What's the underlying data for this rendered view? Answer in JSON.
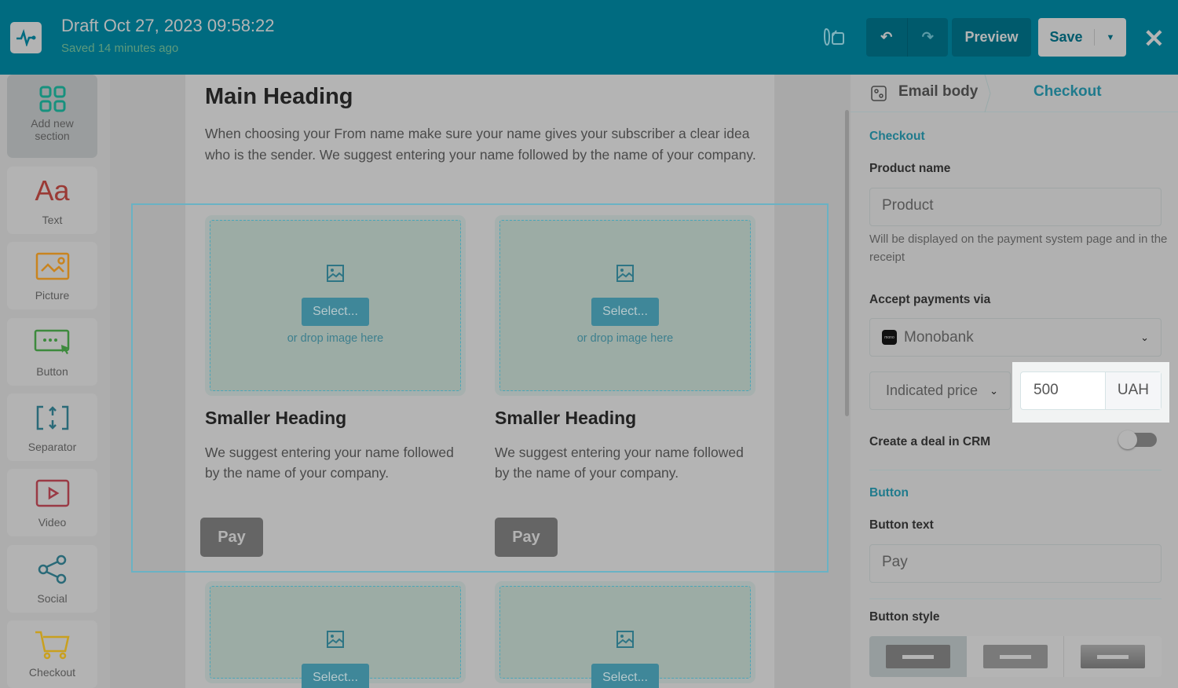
{
  "header": {
    "title": "Draft Oct 27, 2023 09:58:22",
    "subtitle": "Saved 14 minutes ago",
    "preview": "Preview",
    "save": "Save"
  },
  "sidebar": {
    "items": [
      {
        "label": "Add new section"
      },
      {
        "label": "Text",
        "glyph": "Aa"
      },
      {
        "label": "Picture"
      },
      {
        "label": "Button"
      },
      {
        "label": "Separator"
      },
      {
        "label": "Video"
      },
      {
        "label": "Social"
      },
      {
        "label": "Checkout"
      }
    ]
  },
  "email": {
    "heading": "Main Heading",
    "paragraph": "When choosing your From name make sure your name gives your subscriber a clear idea who is the sender. We suggest entering your name followed by the name of your company.",
    "columns": [
      {
        "select": "Select...",
        "drop": "or drop image here",
        "heading": "Smaller Heading",
        "text": "We suggest entering your name followed by the name of your company.",
        "button": "Pay"
      },
      {
        "select": "Select...",
        "drop": "or drop image here",
        "heading": "Smaller Heading",
        "text": "We suggest entering your name followed by the name of your company.",
        "button": "Pay"
      }
    ],
    "next_row": [
      {
        "select": "Select..."
      },
      {
        "select": "Select..."
      }
    ]
  },
  "panel": {
    "breadcrumb": {
      "root": "Email body",
      "current": "Checkout"
    },
    "checkout_section": "Checkout",
    "product_name_label": "Product name",
    "product_name_value": "Product",
    "product_hint": "Will be displayed on the payment system page and in the receipt",
    "payments_label": "Accept payments via",
    "payment_provider": "Monobank",
    "provider_logo_text": "mono",
    "price_type": "Indicated price",
    "price_value": "500",
    "currency": "UAH",
    "crm_label": "Create a deal in CRM",
    "crm_enabled": false,
    "button_section": "Button",
    "button_text_label": "Button text",
    "button_text_value": "Pay",
    "button_style_label": "Button style",
    "button_style_selected": 0
  }
}
